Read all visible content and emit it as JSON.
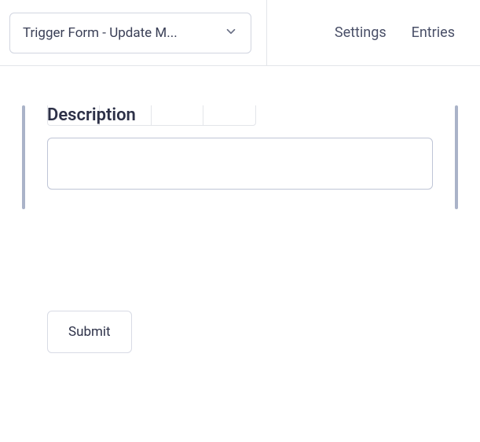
{
  "header": {
    "dropdown_label": "Trigger Form - Update M...",
    "nav": {
      "settings": "Settings",
      "entries": "Entries"
    }
  },
  "form": {
    "description": {
      "label": "Description",
      "value": ""
    },
    "submit_label": "Submit"
  }
}
